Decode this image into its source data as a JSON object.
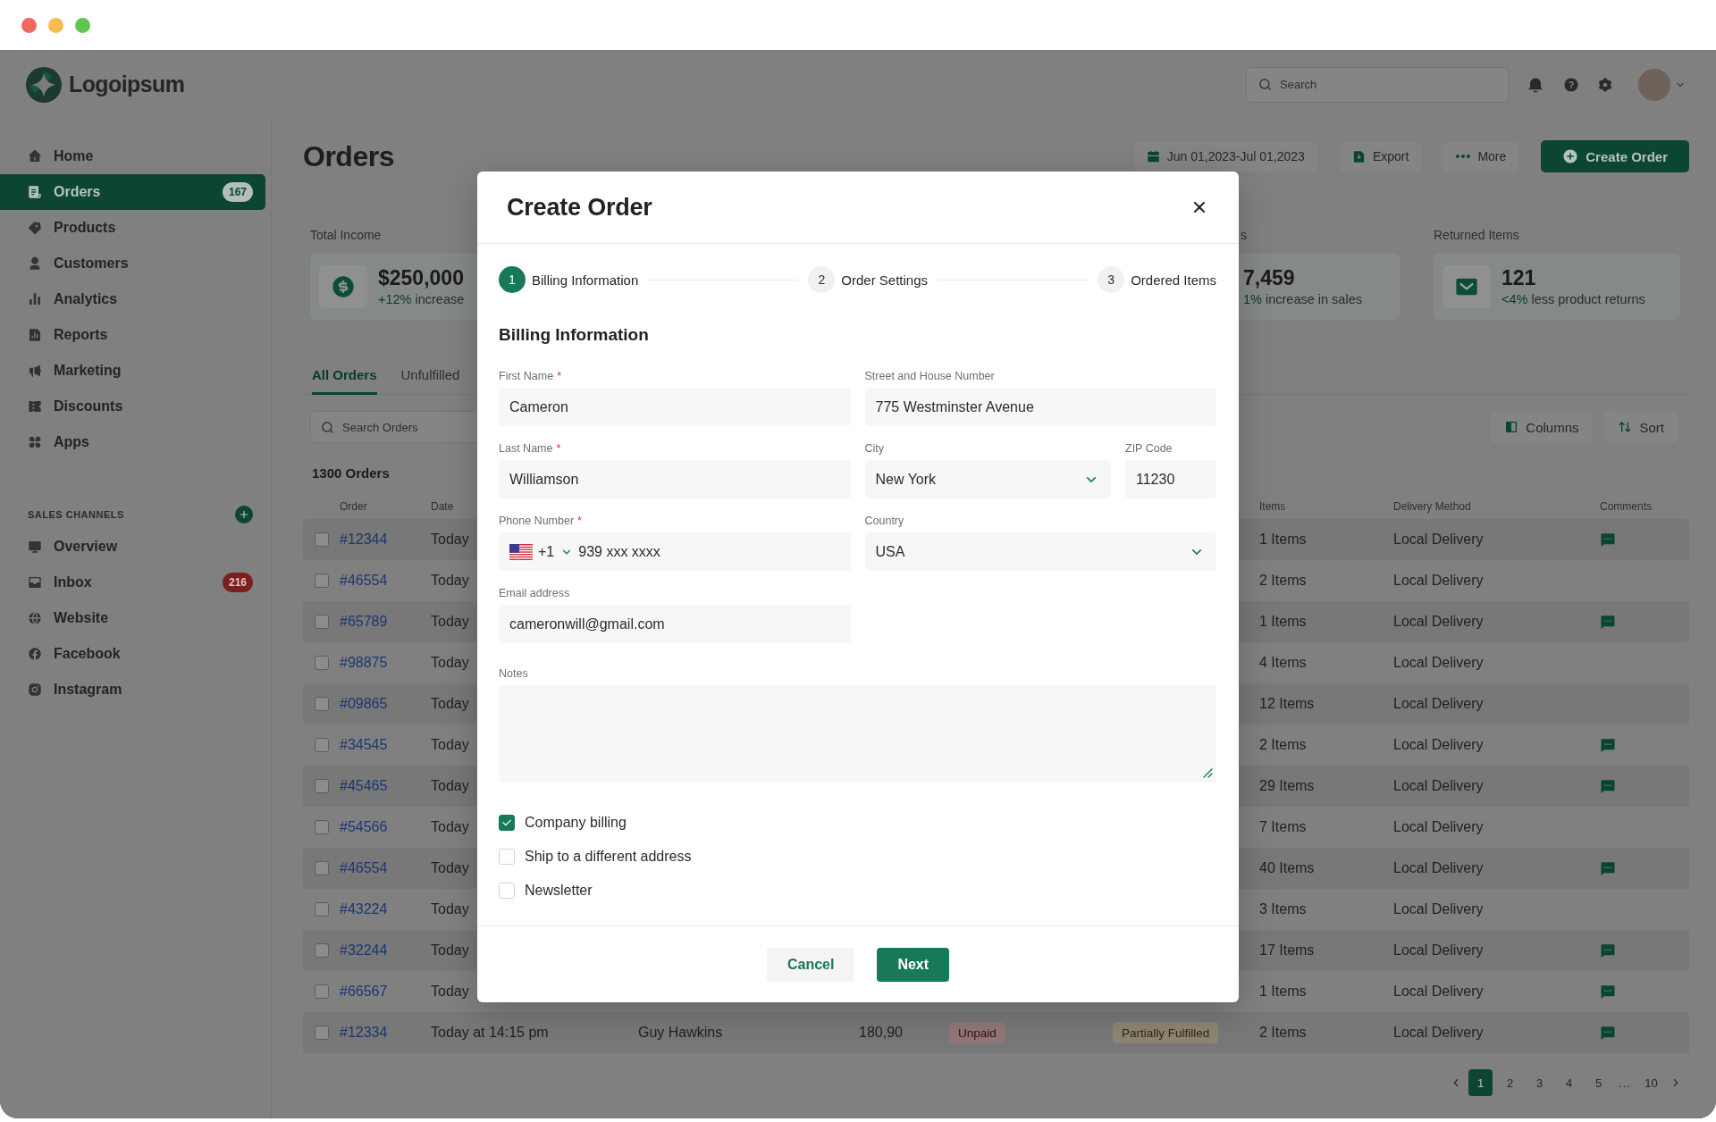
{
  "header": {
    "logo": "Logoipsum",
    "search": {
      "placeholder": "Search"
    }
  },
  "sidebar": {
    "items": [
      {
        "label": "Home",
        "selected": false
      },
      {
        "label": "Orders",
        "selected": true,
        "badge": "167"
      },
      {
        "label": "Products",
        "selected": false
      },
      {
        "label": "Customers",
        "selected": false
      },
      {
        "label": "Analytics",
        "selected": false
      },
      {
        "label": "Reports",
        "selected": false
      },
      {
        "label": "Marketing",
        "selected": false
      },
      {
        "label": "Discounts",
        "selected": false
      },
      {
        "label": "Apps",
        "selected": false
      }
    ],
    "channels_heading": "SALES CHANNELS",
    "channels": [
      {
        "label": "Overview",
        "selected": false
      },
      {
        "label": "Inbox",
        "selected": false,
        "badge": "216"
      },
      {
        "label": "Website",
        "selected": false
      },
      {
        "label": "Facebook",
        "selected": false
      },
      {
        "label": "Instagram",
        "selected": false
      }
    ]
  },
  "page": {
    "title": "Orders",
    "actions": [
      {
        "kind": "date",
        "label": "Jun 01,2023-Jul 01,2023"
      },
      {
        "kind": "export",
        "label": "Export"
      },
      {
        "kind": "more",
        "label": "More"
      },
      {
        "kind": "create",
        "label": "Create Order"
      }
    ],
    "stats": [
      {
        "kind": "money",
        "label": "Total Income",
        "value": "$250,000",
        "change": "+12%",
        "note": "increase"
      },
      {
        "kind": "plain",
        "label": "s",
        "value": "7,459",
        "change": "1%",
        "note": "increase in sales"
      },
      {
        "kind": "returns",
        "label": "Returned Items",
        "value": "121",
        "change": "<4%",
        "note": "less product returns"
      }
    ],
    "tabs": [
      {
        "label": "All Orders",
        "selected": true
      },
      {
        "label": "Unfulfilled",
        "selected": false
      }
    ],
    "search": {
      "placeholder": "Search Orders"
    },
    "tools": [
      {
        "kind": "columns",
        "label": "Columns"
      },
      {
        "kind": "sort",
        "label": "Sort"
      }
    ],
    "count": "1300 Orders",
    "table": {
      "header": {
        "order": "Order",
        "date": "Date",
        "items": "Items",
        "delivery": "Delivery Method",
        "comments": "Comments"
      },
      "rows": [
        {
          "checked": false,
          "order": "#12344",
          "date": "Today",
          "items": "1 Items",
          "delivery": "Local Delivery",
          "comment": true
        },
        {
          "checked": false,
          "order": "#46554",
          "date": "Today",
          "items": "2 Items",
          "delivery": "Local Delivery",
          "comment": false
        },
        {
          "checked": false,
          "order": "#65789",
          "date": "Today",
          "items": "1 Items",
          "delivery": "Local Delivery",
          "comment": true
        },
        {
          "checked": false,
          "order": "#98875",
          "date": "Today",
          "items": "4 Items",
          "delivery": "Local Delivery",
          "comment": false
        },
        {
          "checked": false,
          "order": "#09865",
          "date": "Today",
          "items": "12 Items",
          "delivery": "Local Delivery",
          "comment": false
        },
        {
          "checked": false,
          "order": "#34545",
          "date": "Today",
          "items": "2 Items",
          "delivery": "Local Delivery",
          "comment": true
        },
        {
          "checked": false,
          "order": "#45465",
          "date": "Today",
          "items": "29 Items",
          "delivery": "Local Delivery",
          "comment": true
        },
        {
          "checked": false,
          "order": "#54566",
          "date": "Today",
          "items": "7 Items",
          "delivery": "Local Delivery",
          "comment": false
        },
        {
          "checked": false,
          "order": "#46554",
          "date": "Today",
          "items": "40 Items",
          "delivery": "Local Delivery",
          "comment": true
        },
        {
          "checked": false,
          "order": "#43224",
          "date": "Today",
          "items": "3 Items",
          "delivery": "Local Delivery",
          "comment": false
        },
        {
          "checked": false,
          "order": "#32244",
          "date": "Today",
          "items": "17 Items",
          "delivery": "Local Delivery",
          "comment": true
        },
        {
          "checked": false,
          "order": "#66567",
          "date": "Today",
          "items": "1 Items",
          "delivery": "Local Delivery",
          "comment": true
        },
        {
          "checked": false,
          "order": "#12334",
          "date": "Today at 14:15 pm",
          "customer": "Guy Hawkins",
          "total": "180,90",
          "payment": "Unpaid",
          "fulfillment": "Partially Fulfilled",
          "items": "2 Items",
          "delivery": "Local Delivery",
          "comment": true
        }
      ]
    },
    "pagination": [
      {
        "kind": "page",
        "label": "1",
        "selected": true
      },
      {
        "kind": "page",
        "label": "2",
        "selected": false
      },
      {
        "kind": "page",
        "label": "3",
        "selected": false
      },
      {
        "kind": "page",
        "label": "4",
        "selected": false
      },
      {
        "kind": "page",
        "label": "5",
        "selected": false
      },
      {
        "kind": "gap",
        "label": "...",
        "selected": false
      },
      {
        "kind": "page",
        "label": "10",
        "selected": false
      }
    ]
  },
  "modal": {
    "title": "Create Order",
    "steps": [
      {
        "number": "1",
        "label": "Billing Information",
        "selected": true
      },
      {
        "number": "2",
        "label": "Order Settings",
        "selected": false
      },
      {
        "number": "3",
        "label": "Ordered Items",
        "selected": false
      }
    ],
    "section_title": "Billing Information",
    "form_rows": [
      [
        {
          "kind": "text",
          "label": "First Name",
          "required_mark": "*",
          "value": "Cameron"
        },
        {
          "kind": "text",
          "label": "Street and House Number",
          "value": "775 Westminster Avenue"
        }
      ],
      [
        {
          "kind": "text",
          "label": "Last Name",
          "required_mark": "*",
          "value": "Williamson"
        },
        {
          "kind": "select",
          "label": "City",
          "value": "New York"
        },
        {
          "kind": "text",
          "label": "ZIP Code",
          "value": "11230"
        }
      ],
      [
        {
          "kind": "phone",
          "label": "Phone Number",
          "required_mark": "*",
          "code": "+1",
          "value": "939 xxx xxxx"
        },
        {
          "kind": "select",
          "label": "Country",
          "value": "USA"
        }
      ],
      [
        {
          "kind": "text",
          "label": "Email address",
          "value": "cameronwill@gmail.com"
        }
      ],
      [
        {
          "kind": "textarea",
          "label": "Notes"
        }
      ]
    ],
    "options": [
      {
        "label": "Company billing",
        "checked": true
      },
      {
        "label": "Ship to a different address",
        "checked": false
      },
      {
        "label": "Newsletter",
        "checked": false
      }
    ],
    "buttons": [
      {
        "kind": "secondary",
        "label": "Cancel"
      },
      {
        "kind": "primary",
        "label": "Next"
      }
    ]
  }
}
